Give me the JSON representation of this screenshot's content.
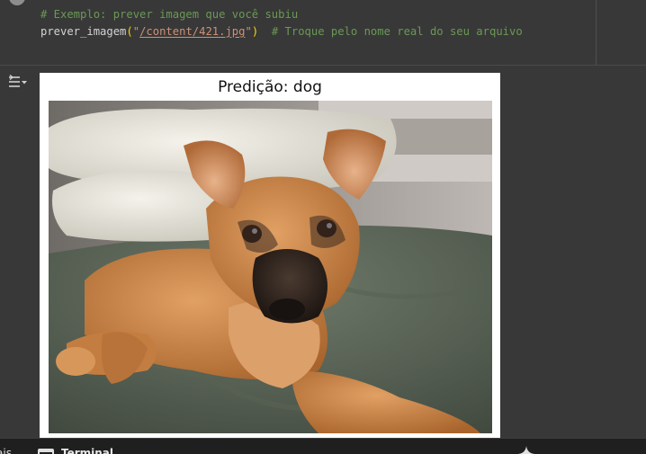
{
  "code": {
    "line1_comment": "# Exemplo: prever imagem que você subiu",
    "line2_fn": "prever_imagem",
    "line2_open": "(",
    "line2_quote_open": "\"",
    "line2_path": "/content/421.jpg",
    "line2_quote_close": "\"",
    "line2_close": ")",
    "line2_comment": "  # Troque pelo nome real do seu arquivo"
  },
  "output": {
    "toggle_icon": "output-collapse-icon",
    "figure_title": "Predição: dog",
    "image_subject": "dog"
  },
  "status_bar": {
    "left_cut_text": "ais",
    "terminal_label": "Terminal",
    "terminal_icon": "terminal-icon",
    "sparkle_icon": "gemini-sparkle-icon"
  },
  "colors": {
    "editor_bg": "#383838",
    "comment": "#6a9955",
    "string": "#ce9178",
    "paren": "#ffd700",
    "statusbar_bg": "#1f1f1f"
  }
}
